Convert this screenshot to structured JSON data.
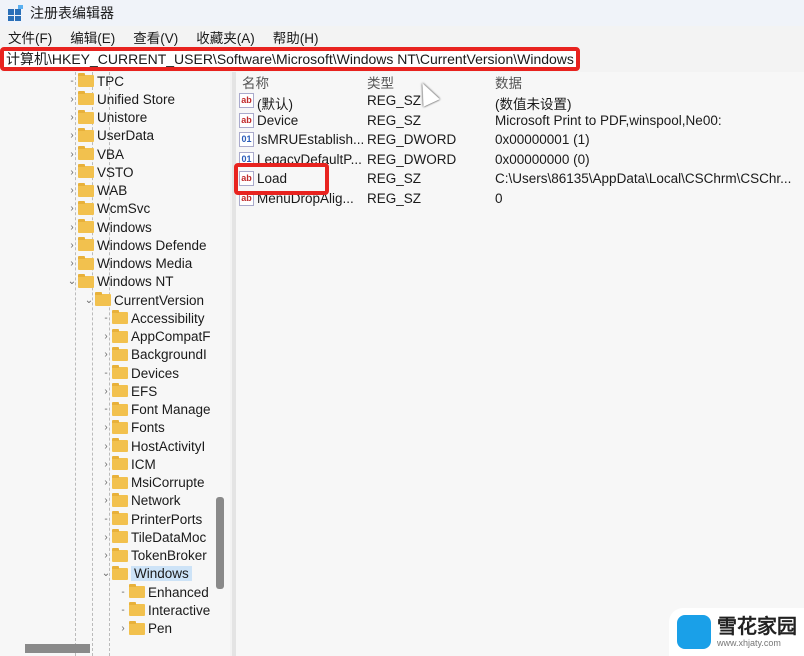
{
  "window": {
    "title": "注册表编辑器"
  },
  "menu": [
    "文件(F)",
    "编辑(E)",
    "查看(V)",
    "收藏夹(A)",
    "帮助(H)"
  ],
  "address": "计算机\\HKEY_CURRENT_USER\\Software\\Microsoft\\Windows NT\\CurrentVersion\\Windows",
  "tree": [
    {
      "label": "TPC",
      "level": 1,
      "arrow": ""
    },
    {
      "label": "Unified Store",
      "level": 1,
      "arrow": ">"
    },
    {
      "label": "Unistore",
      "level": 1,
      "arrow": ">"
    },
    {
      "label": "UserData",
      "level": 1,
      "arrow": ">"
    },
    {
      "label": "VBA",
      "level": 1,
      "arrow": ">"
    },
    {
      "label": "VSTO",
      "level": 1,
      "arrow": ">"
    },
    {
      "label": "WAB",
      "level": 1,
      "arrow": ">"
    },
    {
      "label": "WcmSvc",
      "level": 1,
      "arrow": ">"
    },
    {
      "label": "Windows",
      "level": 1,
      "arrow": ">"
    },
    {
      "label": "Windows Defende",
      "level": 1,
      "arrow": ">"
    },
    {
      "label": "Windows Media",
      "level": 1,
      "arrow": ">"
    },
    {
      "label": "Windows NT",
      "level": 1,
      "arrow": "v"
    },
    {
      "label": "CurrentVersion",
      "level": 2,
      "arrow": "v"
    },
    {
      "label": "Accessibility",
      "level": 3,
      "arrow": ""
    },
    {
      "label": "AppCompatF",
      "level": 3,
      "arrow": ">"
    },
    {
      "label": "BackgroundI",
      "level": 3,
      "arrow": ">"
    },
    {
      "label": "Devices",
      "level": 3,
      "arrow": ""
    },
    {
      "label": "EFS",
      "level": 3,
      "arrow": ">"
    },
    {
      "label": "Font Manage",
      "level": 3,
      "arrow": ""
    },
    {
      "label": "Fonts",
      "level": 3,
      "arrow": ">"
    },
    {
      "label": "HostActivityI",
      "level": 3,
      "arrow": ">"
    },
    {
      "label": "ICM",
      "level": 3,
      "arrow": ">"
    },
    {
      "label": "MsiCorrupte",
      "level": 3,
      "arrow": ">"
    },
    {
      "label": "Network",
      "level": 3,
      "arrow": ">"
    },
    {
      "label": "PrinterPorts",
      "level": 3,
      "arrow": ""
    },
    {
      "label": "TileDataMoc",
      "level": 3,
      "arrow": ">"
    },
    {
      "label": "TokenBroker",
      "level": 3,
      "arrow": ">"
    },
    {
      "label": "Windows",
      "level": 3,
      "arrow": "v",
      "selected": true
    },
    {
      "label": "Enhanced",
      "level": 4,
      "arrow": ""
    },
    {
      "label": "Interactive",
      "level": 4,
      "arrow": ""
    },
    {
      "label": "Pen",
      "level": 4,
      "arrow": ">"
    }
  ],
  "columns": {
    "name": "名称",
    "type": "类型",
    "data": "数据"
  },
  "values": [
    {
      "icon": "string-value-icon",
      "name": "(默认)",
      "type": "REG_SZ",
      "data": "(数值未设置)"
    },
    {
      "icon": "string-value-icon",
      "name": "Device",
      "type": "REG_SZ",
      "data": "Microsoft Print to PDF,winspool,Ne00:"
    },
    {
      "icon": "dword-value-icon",
      "name": "IsMRUEstablish...",
      "type": "REG_DWORD",
      "data": "0x00000001 (1)"
    },
    {
      "icon": "dword-value-icon",
      "name": "LegacyDefaultP...",
      "type": "REG_DWORD",
      "data": "0x00000000 (0)"
    },
    {
      "icon": "string-value-icon",
      "name": "Load",
      "type": "REG_SZ",
      "data": "C:\\Users\\86135\\AppData\\Local\\CSChrm\\CSChr..."
    },
    {
      "icon": "string-value-icon",
      "name": "MenuDropAlig...",
      "type": "REG_SZ",
      "data": "0"
    }
  ],
  "watermark": {
    "name": "雪花家园",
    "url": "www.xhjaty.com"
  },
  "colors": {
    "highlight": "#e8231f",
    "selection": "#cde3f7",
    "folder": "#f2c14e"
  }
}
